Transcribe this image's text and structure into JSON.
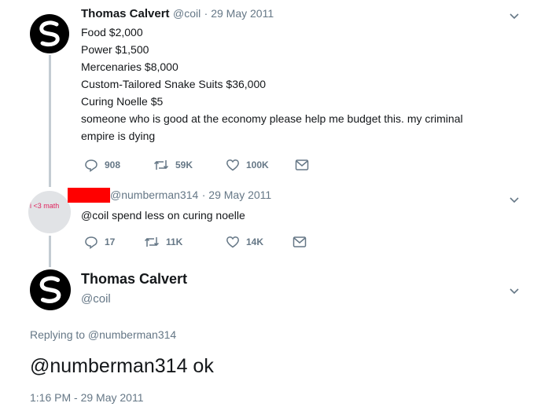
{
  "tweet1": {
    "name": "Thomas Calvert",
    "handle": "@coil",
    "date": "· 29 May 2011",
    "lines": [
      "Food $2,000",
      "Power $1,500",
      "Mercenaries $8,000",
      "Custom-Tailored Snake Suits $36,000",
      "Curing Noelle $5",
      "someone who is good at the economy please help me budget this. my criminal",
      "empire is dying"
    ],
    "replies": "908",
    "retweets": "59K",
    "likes": "100K"
  },
  "tweet2": {
    "avatar_label": "i <3 math",
    "handle": "@numberman314",
    "date": "· 29 May 2011",
    "text": "@coil spend less on curing noelle",
    "replies": "17",
    "retweets": "11K",
    "likes": "14K"
  },
  "tweet3": {
    "name": "Thomas Calvert",
    "handle": "@coil",
    "replying_to": "Replying to @numberman314",
    "text": "@numberman314 ok",
    "timestamp": "1:16 PM - 29 May 2011"
  },
  "colors": {
    "text": "#14171a",
    "secondary": "#657786",
    "thread_line": "#c4ccd3",
    "redaction": "#ff0000"
  },
  "icons": [
    "snake-logo-icon",
    "chevron-down-icon",
    "reply-icon",
    "retweet-icon",
    "like-icon",
    "message-icon"
  ]
}
